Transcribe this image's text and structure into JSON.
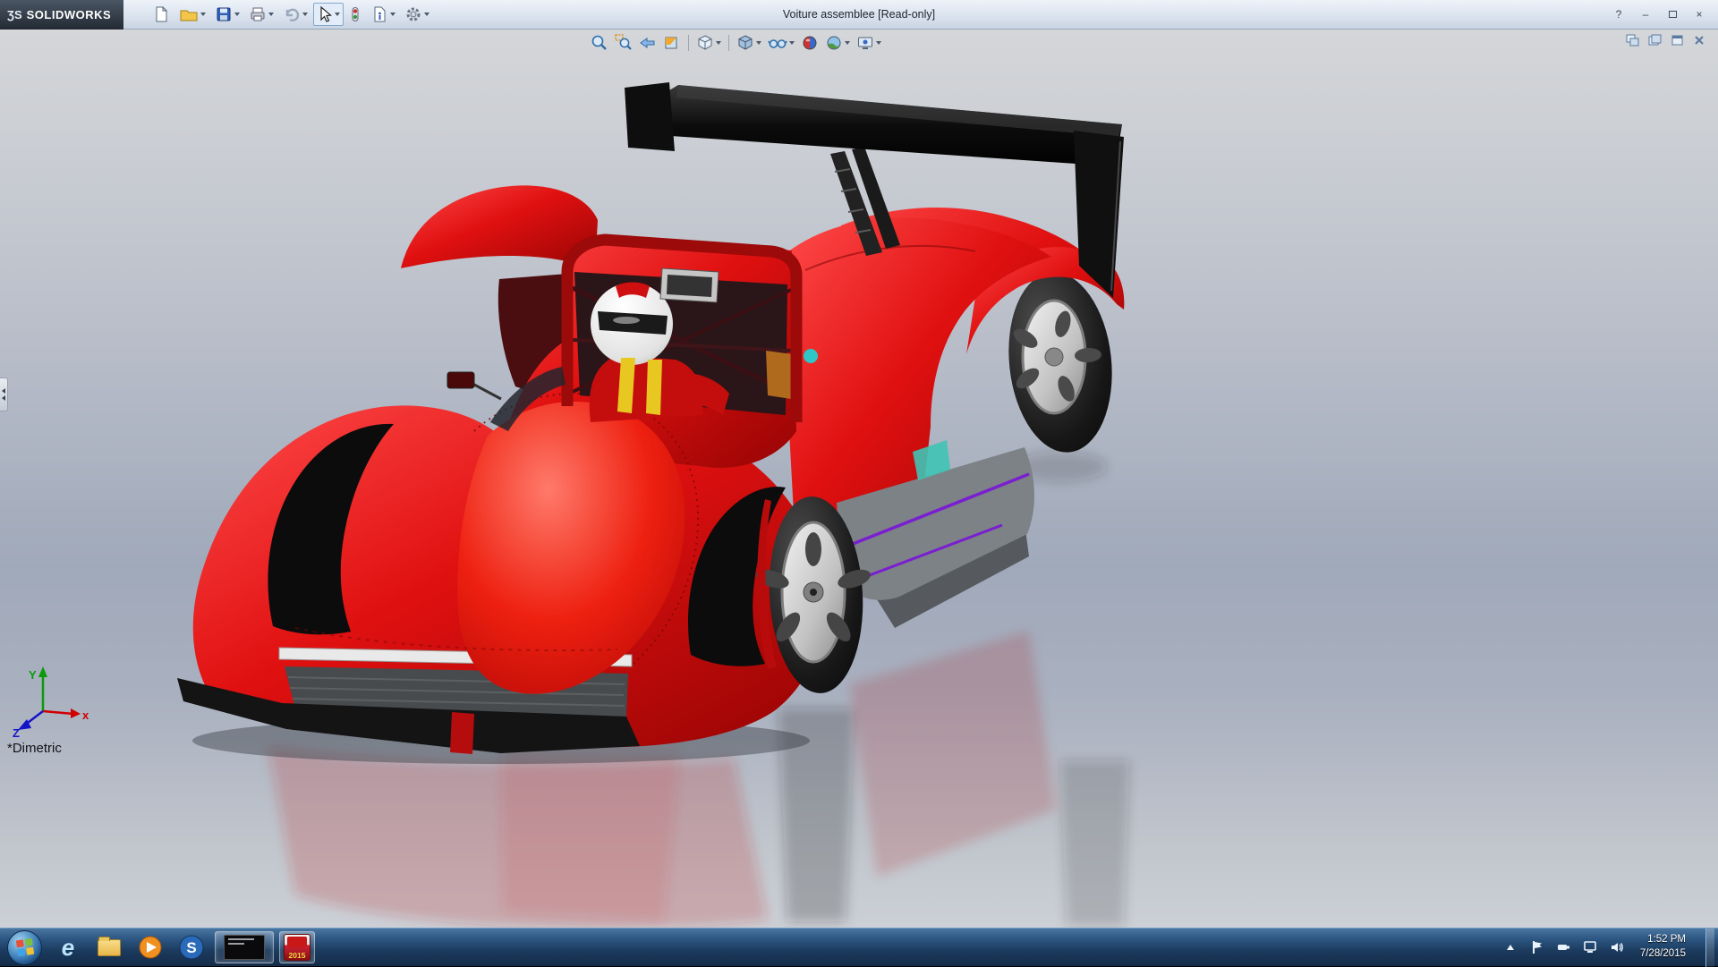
{
  "app": {
    "logo_ds": "ƷS",
    "logo_name": "SOLIDWORKS"
  },
  "window": {
    "title": "Voiture assemblee [Read-only]",
    "help_label": "?",
    "minimize_glyph": "–",
    "close_glyph": "×"
  },
  "main_toolbar": {
    "items": [
      "new-document",
      "open",
      "save",
      "print",
      "undo",
      "select",
      "rebuild",
      "file-properties",
      "options"
    ]
  },
  "heads_up_toolbar": {
    "items": [
      "zoom-to-fit",
      "zoom-to-area",
      "previous-view",
      "section-view",
      "view-orientation",
      "display-style",
      "hide-show-items",
      "edit-appearance",
      "apply-scene",
      "view-settings"
    ]
  },
  "document_controls": {
    "items": [
      "tile-window",
      "cascade-window",
      "restore-window",
      "close-document"
    ]
  },
  "viewport": {
    "orientation_label": "*Dimetric",
    "triad": {
      "x": "x",
      "y": "Y",
      "z": "Z"
    },
    "model_name": "red-race-car-assembly",
    "colors": {
      "car_red": "#e01010",
      "wing_black": "#0d0d0d",
      "accent_purple": "#7a1fd0",
      "rim_silver": "#cfcfcf"
    }
  },
  "taskbar": {
    "ie_glyph": "e",
    "sw_glyph": "S",
    "sw2015_year": "2015",
    "clock_time": "1:52 PM",
    "clock_date": "7/28/2015"
  }
}
